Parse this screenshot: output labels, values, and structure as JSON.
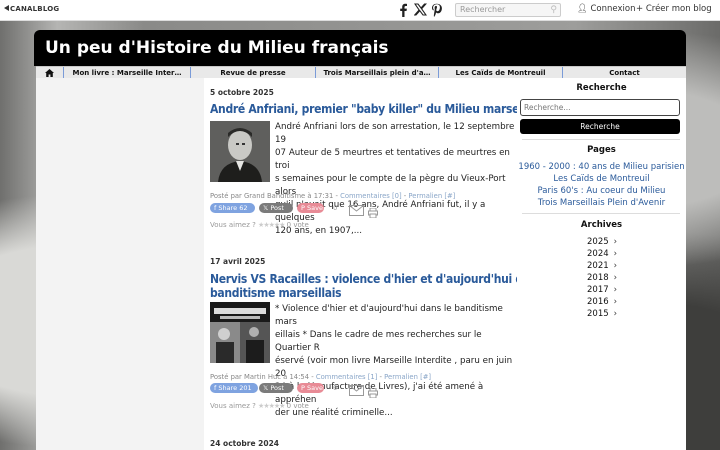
{
  "topbar": {
    "logo": "CANALBLOG",
    "search_placeholder": "Rechercher",
    "login": "Connexion",
    "create": "Créer mon blog"
  },
  "blog": {
    "title": "Un peu d'Histoire du Milieu français"
  },
  "nav": {
    "items": [
      "Mon livre : Marseille Inter…",
      "Revue de presse",
      "Trois Marseillais plein d'a…",
      "Les Caïds de Montreuil",
      "Contact"
    ]
  },
  "posts": [
    {
      "date": "5 octobre 2025",
      "title": "André Anfriani, premier \"baby killer\" du Milieu marseillais",
      "lines": [
        "André Anfriani lors de son arrestation, le 12 septembre 19",
        "07 Auteur de 5 meurtres et tentatives de meurtres en troi",
        "s semaines pour le compte de la pègre du Vieux-Port alors",
        "qu'il n'avait que 16 ans, André Anfriani fut, il y a quelques",
        "120 ans, en 1907,..."
      ],
      "meta_prefix": "Posté par Grand Banditisme à 17:31 -",
      "comments": "Commentaires [0]",
      "permalink": "Permalien [#]",
      "share_count": "62",
      "save_count": "0",
      "vote_label": "Vous aimez ?",
      "vote_count": "0 vote"
    },
    {
      "date": "17 avril 2025",
      "title_line1": "Nervis VS Racailles : violence d'hier et d'aujourd'hui dans le",
      "title_line2": "banditisme marseillais",
      "lines": [
        "* Violence d'hier et d'aujourd'hui dans le banditisme mars",
        "eillais * Dans le cadre de mes recherches sur le Quartier R",
        "éservé (voir mon livre Marseille Interdite , paru en juin 20",
        "24 à la Manufacture de Livres), j'ai été amené à appréhen",
        "der une réalité criminelle..."
      ],
      "meta_prefix": "Posté par Martin Huc à 14:54 -",
      "comments": "Commentaires [1]",
      "permalink": "Permalien [#]",
      "share_count": "201",
      "save_count": "0",
      "vote_label": "Vous aimez ?",
      "vote_count": "0 vote"
    },
    {
      "date": "24 octobre 2024"
    }
  ],
  "share": {
    "facebook": "Share",
    "x": "Post",
    "pinterest": "Save"
  },
  "sidebar": {
    "search_title": "Recherche",
    "search_placeholder": "Recherche...",
    "search_button": "Recherche",
    "pages_title": "Pages",
    "pages": [
      "1960 - 2000 : 40 ans de Milieu parisien",
      "Les Caïds de Montreuil",
      "Paris 60's : Au coeur du Milieu",
      "Trois Marseillais Plein d'Avenir"
    ],
    "archives_title": "Archives",
    "archives": [
      "2025",
      "2024",
      "2021",
      "2018",
      "2017",
      "2016",
      "2015"
    ]
  },
  "colors": {
    "link": "#2a5a9a",
    "header_bg": "#000000",
    "facebook": "#7fa3e0",
    "pinterest": "#e88b96"
  }
}
